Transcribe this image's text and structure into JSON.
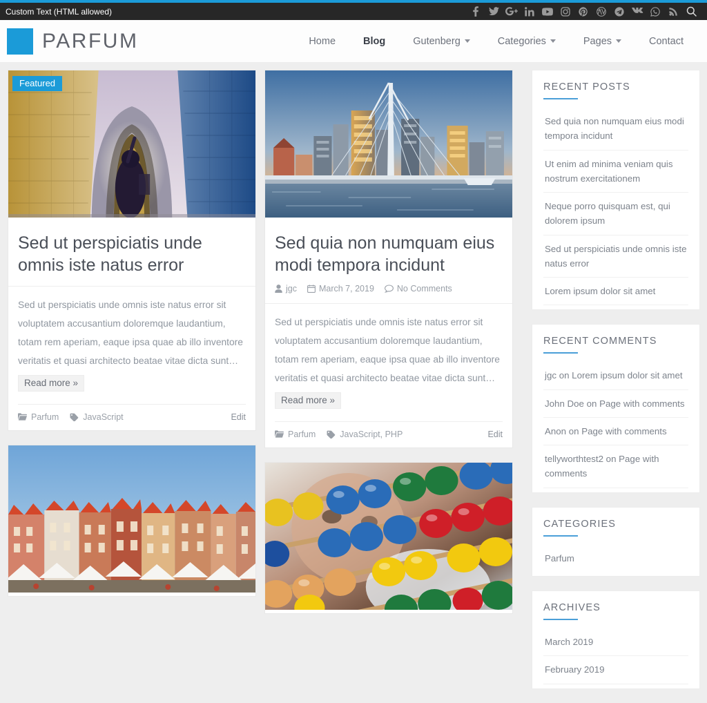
{
  "topbar": {
    "custom_text": "Custom Text (HTML allowed)",
    "social_icons": [
      {
        "name": "facebook-icon",
        "label": "f"
      },
      {
        "name": "twitter-icon",
        "label": "twitter"
      },
      {
        "name": "google-plus-icon",
        "label": "G+"
      },
      {
        "name": "linkedin-icon",
        "label": "in"
      },
      {
        "name": "youtube-icon",
        "label": "youtube"
      },
      {
        "name": "instagram-icon",
        "label": "instagram"
      },
      {
        "name": "pinterest-icon",
        "label": "pinterest"
      },
      {
        "name": "wordpress-icon",
        "label": "wordpress"
      },
      {
        "name": "telegram-icon",
        "label": "telegram"
      },
      {
        "name": "vk-icon",
        "label": "vk"
      },
      {
        "name": "whatsapp-icon",
        "label": "whatsapp"
      },
      {
        "name": "rss-icon",
        "label": "rss"
      },
      {
        "name": "search-icon",
        "label": "search"
      }
    ]
  },
  "header": {
    "brand_name": "PARFUM",
    "accent_color": "#1b9bd8",
    "nav": [
      {
        "label": "Home",
        "active": false,
        "has_dropdown": false
      },
      {
        "label": "Blog",
        "active": true,
        "has_dropdown": false
      },
      {
        "label": "Gutenberg",
        "active": false,
        "has_dropdown": true
      },
      {
        "label": "Categories",
        "active": false,
        "has_dropdown": true
      },
      {
        "label": "Pages",
        "active": false,
        "has_dropdown": true
      },
      {
        "label": "Contact",
        "active": false,
        "has_dropdown": false
      }
    ]
  },
  "posts": [
    {
      "badge": "Featured",
      "title": "Sed ut perspiciatis unde omnis iste natus error",
      "meta": null,
      "excerpt": "Sed ut perspiciatis unde omnis iste natus error sit voluptatem accusantium doloremque laudantium, totam rem aperiam, eaque ipsa quae ab illo inventore veritatis et quasi architecto beatae vitae dicta sunt…",
      "read_more": "Read more »",
      "category": "Parfum",
      "tags": "JavaScript",
      "edit": "Edit",
      "image": "archway-stone-tunnel"
    },
    {
      "badge": null,
      "title": "Sed quia non numquam eius modi tempora incidunt",
      "meta": {
        "author": "jgc",
        "date": "March 7, 2019",
        "comments": "No Comments"
      },
      "excerpt": "Sed ut perspiciatis unde omnis iste natus error sit voluptatem accusantium doloremque laudantium, totam rem aperiam, eaque ipsa quae ab illo inventore veritatis et quasi architecto beatae vitae dicta sunt…",
      "read_more": "Read more »",
      "category": "Parfum",
      "tags": "JavaScript, PHP",
      "edit": "Edit",
      "image": "rotterdam-erasmus-bridge-skyline"
    },
    {
      "badge": null,
      "title": null,
      "meta": null,
      "excerpt": null,
      "read_more": null,
      "category": null,
      "tags": null,
      "edit": null,
      "image": "old-town-square-market"
    },
    {
      "badge": null,
      "title": null,
      "meta": null,
      "excerpt": null,
      "read_more": null,
      "category": null,
      "tags": null,
      "edit": null,
      "image": "colorful-abacus-beads"
    }
  ],
  "sidebar": {
    "widgets": [
      {
        "title": "Recent Posts",
        "items": [
          "Sed quia non numquam eius modi tempora incidunt",
          "Ut enim ad minima veniam quis nostrum exercitationem",
          "Neque porro quisquam est, qui dolorem ipsum",
          "Sed ut perspiciatis unde omnis iste natus error",
          "Lorem ipsum dolor sit amet"
        ]
      },
      {
        "title": "Recent Comments",
        "items": [
          "jgc on Lorem ipsum dolor sit amet",
          "John Doe on Page with comments",
          "Anon on Page with comments",
          "tellyworthtest2 on Page with comments"
        ]
      },
      {
        "title": "Categories",
        "items": [
          "Parfum"
        ]
      },
      {
        "title": "Archives",
        "items": [
          "March 2019",
          "February 2019"
        ]
      }
    ]
  }
}
